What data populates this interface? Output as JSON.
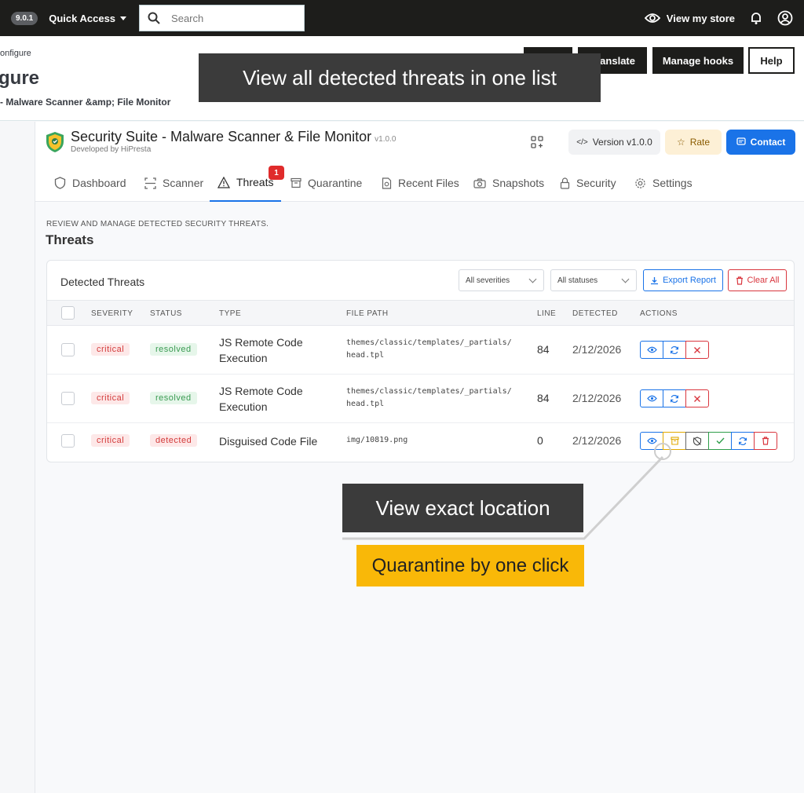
{
  "topbar": {
    "version": "9.0.1",
    "quick_access": "Quick Access",
    "search_placeholder": "Search",
    "view_store": "View my store"
  },
  "header": {
    "breadcrumb": "onfigure",
    "title": "gure",
    "subtitle": "- Malware Scanner &amp; File Monitor",
    "buttons": {
      "translate": "ranslate",
      "hooks": "Manage hooks",
      "help": "Help"
    }
  },
  "module": {
    "title": "Security Suite - Malware Scanner & File Monitor",
    "version": "v1.0.0",
    "developer": "Developed by HiPresta",
    "btn_version": "Version v1.0.0",
    "btn_rate": "Rate",
    "btn_contact": "Contact"
  },
  "tabs": [
    {
      "label": "Dashboard",
      "icon": "shield-icon"
    },
    {
      "label": "Scanner",
      "icon": "scan-icon"
    },
    {
      "label": "Threats",
      "icon": "warning-icon",
      "badge": "1"
    },
    {
      "label": "Quarantine",
      "icon": "archive-icon"
    },
    {
      "label": "Recent Files",
      "icon": "file-icon"
    },
    {
      "label": "Snapshots",
      "icon": "camera-icon"
    },
    {
      "label": "Security",
      "icon": "lock-icon"
    },
    {
      "label": "Settings",
      "icon": "gear-icon"
    }
  ],
  "section": {
    "kicker": "REVIEW AND MANAGE DETECTED SECURITY THREATS.",
    "title": "Threats"
  },
  "card": {
    "title": "Detected Threats",
    "severity_filter": "All severities",
    "status_filter": "All statuses",
    "export": "Export Report",
    "clear": "Clear All",
    "columns": [
      "SEVERITY",
      "STATUS",
      "TYPE",
      "FILE PATH",
      "LINE",
      "DETECTED",
      "ACTIONS"
    ],
    "rows": [
      {
        "severity": "critical",
        "status": "resolved",
        "type": "JS Remote Code Execution",
        "path1": "themes/classic/templates/_partials/",
        "path2": "head.tpl",
        "line": "84",
        "detected": "2/12/2026"
      },
      {
        "severity": "critical",
        "status": "resolved",
        "type": "JS Remote Code Execution",
        "path1": "themes/classic/templates/_partials/",
        "path2": "head.tpl",
        "line": "84",
        "detected": "2/12/2026"
      },
      {
        "severity": "critical",
        "status": "detected",
        "type": "Disguised Code File",
        "path1": "img/10819.png",
        "path2": "",
        "line": "0",
        "detected": "2/12/2026"
      }
    ]
  },
  "overlays": {
    "top": "View all detected threats in one list",
    "location": "View exact location",
    "quarantine": "Quarantine by one click"
  },
  "colors": {
    "accent": "#1a73e8",
    "danger": "#d9363e",
    "callout": "#f9b808"
  }
}
